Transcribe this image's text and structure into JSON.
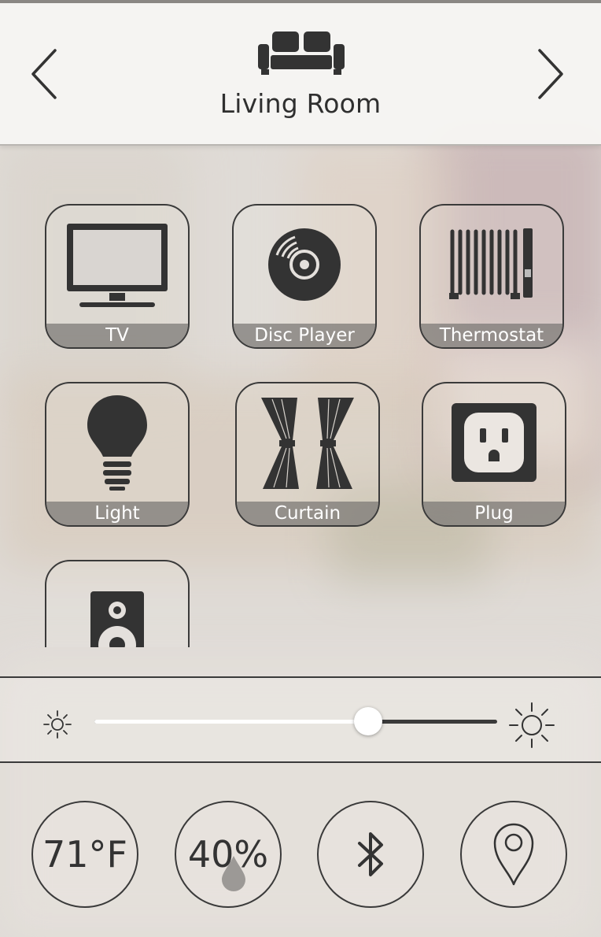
{
  "header": {
    "room_title": "Living Room",
    "room_icon": "sofa-icon",
    "prev_icon": "chevron-left-icon",
    "next_icon": "chevron-right-icon"
  },
  "devices": [
    {
      "label": "TV",
      "icon": "tv-icon"
    },
    {
      "label": "Disc Player",
      "icon": "disc-icon"
    },
    {
      "label": "Thermostat",
      "icon": "radiator-icon"
    },
    {
      "label": "Light",
      "icon": "bulb-icon"
    },
    {
      "label": "Curtain",
      "icon": "curtain-icon"
    },
    {
      "label": "Plug",
      "icon": "outlet-icon"
    },
    {
      "label": "",
      "icon": "speaker-icon"
    }
  ],
  "brightness": {
    "level": 0.68,
    "min_icon": "sun-small-icon",
    "max_icon": "sun-large-icon"
  },
  "status": {
    "temperature": "71°F",
    "humidity": "40%",
    "humidity_icon": "water-drop-icon",
    "bluetooth_icon": "bluetooth-icon",
    "location_icon": "location-pin-icon"
  },
  "colors": {
    "outline": "#3a3a3a",
    "label_band": "#787673",
    "header_bg": "#f6f5f3"
  }
}
